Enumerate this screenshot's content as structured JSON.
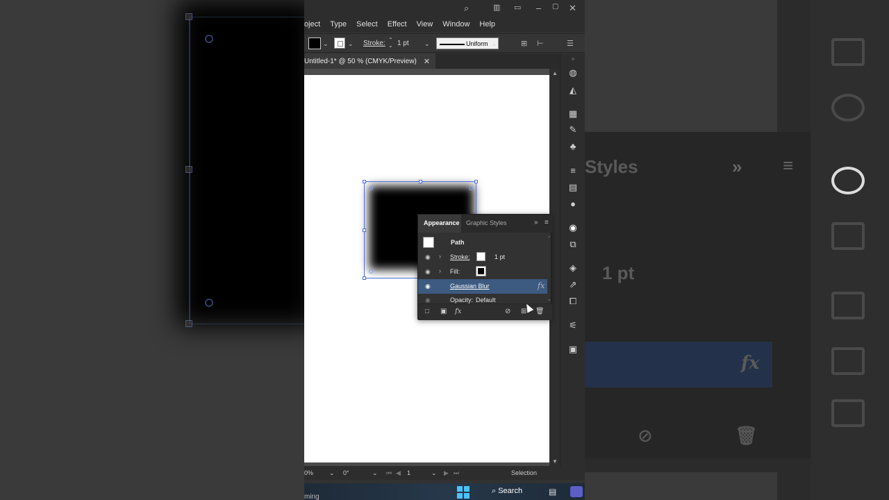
{
  "menu": [
    "oject",
    "Type",
    "Select",
    "Effect",
    "View",
    "Window",
    "Help"
  ],
  "control_bar": {
    "stroke_label": "Stroke:",
    "stroke_weight": "1 pt",
    "profile": "Uniform"
  },
  "document": {
    "tab_title": "Untitled-1* @ 50 % (CMYK/Preview)",
    "close_glyph": "✕"
  },
  "appearance_panel": {
    "tab_active": "Appearance",
    "tab_inactive": "Graphic Styles",
    "object_type": "Path",
    "rows": {
      "stroke_label": "Stroke:",
      "stroke_value": "1 pt",
      "fill_label": "Fill:",
      "effect_label": "Gaussian Blur",
      "effect_glyph": "fx",
      "opacity_label": "Opacity:",
      "opacity_value": "Default"
    }
  },
  "status_bar": {
    "zoom": "0%",
    "rotation": "0°",
    "artboard_number": "1",
    "tool": "Selection"
  },
  "taskbar": {
    "search_label": "Search",
    "left_text": "ming"
  },
  "background_right": {
    "styles_text": "Styles",
    "stroke_value": "1 pt",
    "fx_glyph": "fx"
  },
  "colors": {
    "selection_blue": "#4a6ee0",
    "selected_row": "#3d5a80",
    "windows_accent": "#4cc2ff"
  }
}
